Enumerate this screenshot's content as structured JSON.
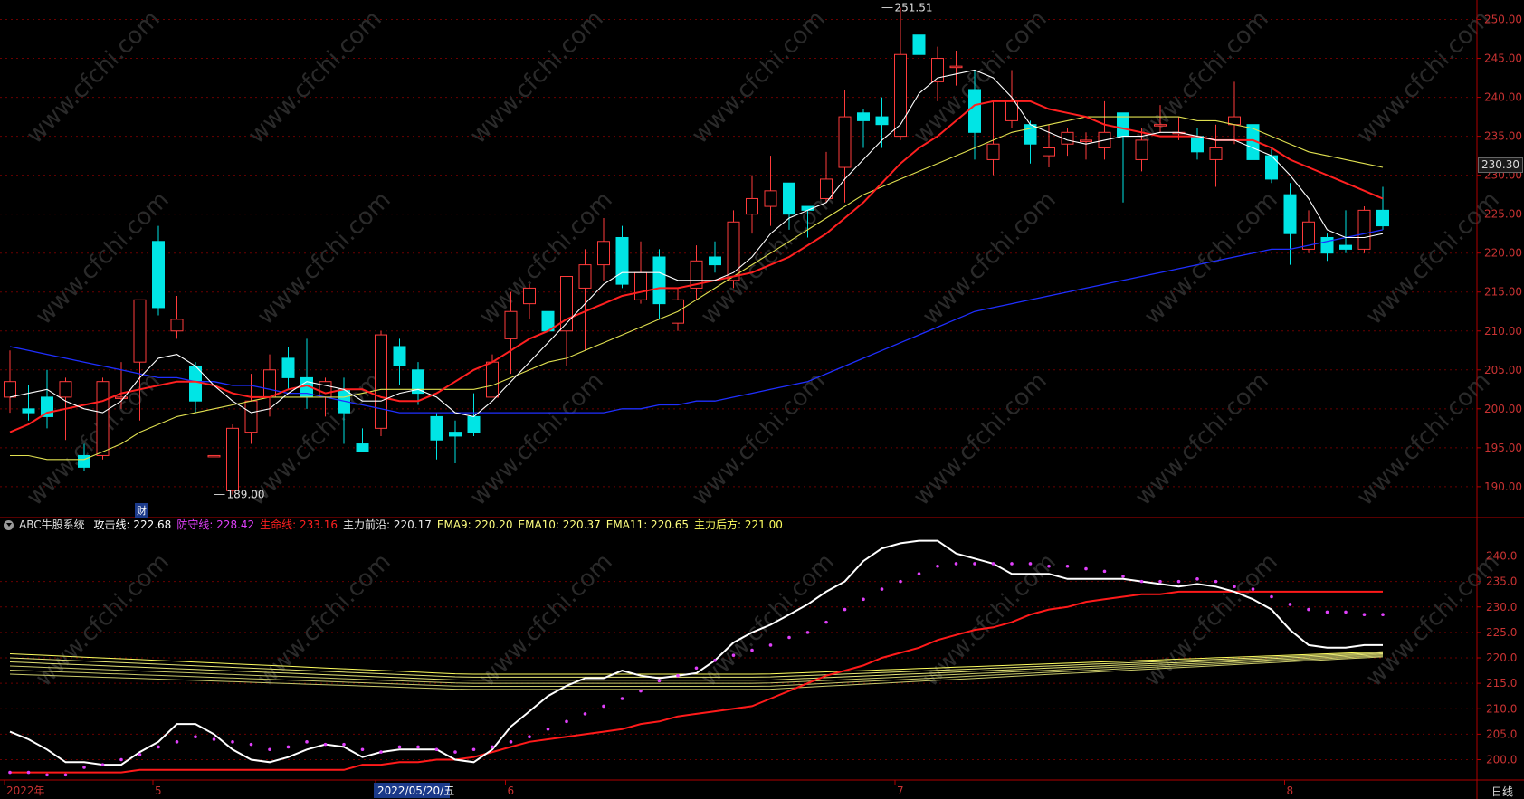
{
  "chart_data": {
    "type": "candlestick",
    "price_axis": {
      "ticks": [
        "190.00",
        "195.00",
        "200.00",
        "205.00",
        "210.00",
        "215.00",
        "220.00",
        "225.00",
        "230.00",
        "235.00",
        "240.00",
        "245.00",
        "250.00"
      ],
      "range": [
        186.5,
        252.5
      ]
    },
    "indicator_axis": {
      "ticks": [
        "200.0",
        "205.0",
        "210.0",
        "215.0",
        "220.0",
        "225.0",
        "230.0",
        "235.0",
        "240.0"
      ],
      "range": [
        196.0,
        244.0
      ]
    },
    "date_labels": [
      {
        "text": "2022年",
        "bar": 0
      },
      {
        "text": "5",
        "bar": 8
      },
      {
        "text": "2022/05/20/五",
        "bar": 20,
        "highlight": true
      },
      {
        "text": "6",
        "bar": 27
      },
      {
        "text": "7",
        "bar": 48
      },
      {
        "text": "8",
        "bar": 69
      }
    ],
    "high_label": {
      "text": "251.51",
      "bar": 47,
      "price": 251.51
    },
    "low_label": {
      "text": "189.00",
      "bar": 11,
      "price": 189.0
    },
    "current_price": "230.30",
    "finance_marker": {
      "text": "财",
      "bar": 7
    },
    "candles": [
      [
        201.5,
        203.5,
        207.5,
        199.5
      ],
      [
        200.0,
        199.5,
        203.0,
        198.5
      ],
      [
        201.5,
        199.0,
        205.0,
        197.5
      ],
      [
        201.5,
        203.5,
        204.0,
        196.0
      ],
      [
        194.0,
        192.5,
        195.5,
        192.0
      ],
      [
        194.0,
        203.5,
        204.0,
        193.5
      ],
      [
        201.5,
        201.5,
        206.0,
        200.0
      ],
      [
        206.0,
        214.0,
        214.0,
        198.5
      ],
      [
        221.5,
        213.0,
        223.5,
        212.0
      ],
      [
        210.0,
        211.5,
        214.5,
        209.0
      ],
      [
        205.5,
        201.0,
        206.0,
        199.5
      ],
      [
        194.0,
        194.0,
        196.5,
        190.0
      ],
      [
        189.5,
        197.5,
        198.0,
        189.0
      ],
      [
        197.0,
        201.0,
        204.5,
        195.5
      ],
      [
        201.5,
        205.0,
        207.0,
        199.0
      ],
      [
        206.5,
        204.0,
        208.0,
        202.5
      ],
      [
        204.0,
        201.5,
        209.0,
        200.0
      ],
      [
        201.5,
        203.5,
        204.0,
        199.0
      ],
      [
        202.5,
        199.5,
        204.0,
        195.5
      ],
      [
        195.5,
        194.5,
        197.5,
        194.5
      ],
      [
        197.5,
        209.5,
        210.0,
        196.5
      ],
      [
        208.0,
        205.5,
        209.0,
        203.0
      ],
      [
        205.0,
        202.0,
        206.0,
        200.5
      ],
      [
        199.0,
        196.0,
        199.5,
        193.5
      ],
      [
        197.0,
        196.5,
        198.5,
        193.0
      ],
      [
        199.0,
        197.0,
        202.0,
        196.5
      ],
      [
        201.5,
        206.0,
        207.0,
        201.5
      ],
      [
        209.0,
        212.5,
        215.0,
        204.5
      ],
      [
        213.5,
        215.5,
        216.0,
        211.5
      ],
      [
        212.5,
        210.0,
        215.5,
        207.5
      ],
      [
        210.0,
        217.0,
        217.0,
        205.5
      ],
      [
        215.5,
        218.5,
        220.5,
        207.5
      ],
      [
        218.5,
        221.5,
        224.5,
        216.5
      ],
      [
        222.0,
        216.0,
        223.5,
        215.5
      ],
      [
        214.0,
        217.5,
        221.5,
        213.5
      ],
      [
        219.5,
        213.5,
        220.5,
        211.5
      ],
      [
        211.0,
        214.0,
        215.5,
        210.0
      ],
      [
        215.5,
        219.0,
        221.0,
        214.0
      ],
      [
        219.5,
        218.5,
        221.5,
        217.5
      ],
      [
        216.5,
        224.0,
        225.5,
        215.5
      ],
      [
        225.0,
        227.0,
        230.0,
        222.5
      ],
      [
        226.0,
        228.0,
        232.5,
        223.5
      ],
      [
        229.0,
        225.0,
        229.0,
        223.0
      ],
      [
        226.0,
        225.5,
        226.0,
        222.0
      ],
      [
        227.0,
        229.5,
        233.0,
        226.5
      ],
      [
        231.0,
        237.5,
        241.0,
        226.5
      ],
      [
        238.0,
        237.0,
        238.5,
        233.5
      ],
      [
        237.5,
        236.5,
        240.0,
        233.5
      ],
      [
        235.0,
        245.5,
        251.5,
        234.5
      ],
      [
        248.0,
        245.5,
        249.5,
        241.0
      ],
      [
        242.0,
        245.0,
        246.5,
        239.5
      ],
      [
        244.0,
        244.0,
        246.0,
        241.5
      ],
      [
        241.0,
        235.5,
        243.5,
        232.0
      ],
      [
        232.0,
        234.0,
        239.5,
        230.0
      ],
      [
        237.0,
        239.5,
        243.5,
        236.0
      ],
      [
        236.5,
        234.0,
        237.0,
        231.5
      ],
      [
        232.5,
        233.5,
        236.5,
        231.0
      ],
      [
        234.0,
        235.5,
        236.0,
        232.5
      ],
      [
        234.5,
        234.5,
        235.5,
        232.0
      ],
      [
        233.5,
        235.5,
        239.5,
        232.0
      ],
      [
        238.0,
        235.0,
        238.0,
        226.5
      ],
      [
        232.0,
        234.5,
        236.0,
        230.5
      ],
      [
        236.5,
        236.5,
        239.0,
        235.5
      ],
      [
        235.5,
        235.5,
        237.5,
        234.5
      ],
      [
        235.0,
        233.0,
        236.0,
        232.0
      ],
      [
        232.0,
        233.5,
        236.5,
        228.5
      ],
      [
        236.5,
        237.5,
        242.0,
        234.0
      ],
      [
        236.5,
        232.0,
        236.5,
        231.5
      ],
      [
        232.5,
        229.5,
        233.5,
        229.0
      ],
      [
        227.5,
        222.5,
        229.0,
        218.5
      ],
      [
        220.5,
        224.0,
        225.5,
        220.0
      ],
      [
        222.0,
        220.0,
        222.5,
        219.0
      ],
      [
        221.0,
        220.5,
        225.5,
        220.0
      ],
      [
        220.5,
        225.5,
        226.0,
        220.0
      ],
      [
        225.5,
        223.5,
        228.5,
        223.0
      ]
    ],
    "ma5": [
      201.5,
      202.0,
      202.5,
      201.0,
      200.0,
      199.5,
      201.0,
      204.0,
      206.5,
      207.0,
      205.5,
      203.0,
      201.0,
      199.5,
      200.0,
      202.0,
      203.5,
      203.0,
      202.5,
      201.0,
      201.0,
      202.0,
      202.5,
      201.5,
      199.5,
      199.0,
      201.0,
      203.5,
      206.0,
      208.5,
      211.0,
      213.5,
      216.0,
      217.5,
      217.5,
      217.5,
      216.5,
      216.5,
      216.5,
      217.5,
      219.5,
      222.5,
      224.5,
      225.5,
      226.5,
      229.5,
      232.0,
      234.5,
      236.5,
      240.5,
      242.5,
      243.0,
      243.5,
      242.5,
      240.0,
      236.5,
      235.5,
      234.5,
      234.0,
      234.5,
      235.0,
      235.0,
      235.5,
      235.5,
      235.0,
      234.5,
      234.5,
      233.5,
      232.5,
      230.0,
      227.0,
      223.0,
      222.0,
      222.0,
      222.5
    ],
    "ma10": [
      197.0,
      198.0,
      199.5,
      200.0,
      200.5,
      201.0,
      202.0,
      202.5,
      203.0,
      203.5,
      203.5,
      203.0,
      202.0,
      201.5,
      201.5,
      202.5,
      203.0,
      202.0,
      202.5,
      202.5,
      201.5,
      201.0,
      201.0,
      202.0,
      203.5,
      205.0,
      206.0,
      207.5,
      209.0,
      210.0,
      211.5,
      212.5,
      213.5,
      214.5,
      215.0,
      215.5,
      215.5,
      216.0,
      216.5,
      217.0,
      217.5,
      218.5,
      219.5,
      221.0,
      222.5,
      224.5,
      226.5,
      229.0,
      231.5,
      233.5,
      235.0,
      237.0,
      239.0,
      239.5,
      239.5,
      239.5,
      238.5,
      238.0,
      237.5,
      236.5,
      236.0,
      235.5,
      235.0,
      235.0,
      235.0,
      234.5,
      234.5,
      234.5,
      233.5,
      232.0,
      231.0,
      230.0,
      229.0,
      228.0,
      227.0
    ],
    "ma20": [
      194.0,
      194.0,
      193.5,
      193.5,
      193.5,
      194.5,
      195.5,
      197.0,
      198.0,
      199.0,
      199.5,
      200.0,
      200.5,
      201.0,
      201.5,
      201.5,
      201.5,
      201.5,
      201.5,
      202.0,
      202.5,
      202.5,
      202.5,
      202.5,
      202.5,
      202.5,
      203.0,
      204.0,
      205.0,
      206.0,
      206.5,
      207.5,
      208.5,
      209.5,
      210.5,
      211.5,
      212.5,
      214.0,
      215.5,
      217.0,
      218.5,
      220.0,
      221.5,
      223.0,
      224.5,
      226.0,
      227.5,
      228.5,
      229.5,
      230.5,
      231.5,
      232.5,
      233.5,
      234.5,
      235.5,
      236.0,
      236.5,
      237.0,
      237.5,
      237.5,
      237.5,
      237.5,
      237.5,
      237.5,
      237.0,
      237.0,
      236.5,
      236.0,
      235.0,
      234.0,
      233.0,
      232.5,
      232.0,
      231.5,
      231.0
    ],
    "ma60": [
      208.0,
      207.5,
      207.0,
      206.5,
      206.0,
      205.5,
      205.0,
      204.5,
      204.0,
      204.0,
      203.5,
      203.5,
      203.0,
      203.0,
      202.5,
      202.0,
      202.0,
      201.5,
      201.0,
      200.5,
      200.0,
      199.5,
      199.5,
      199.5,
      199.5,
      199.5,
      199.5,
      199.5,
      199.5,
      199.5,
      199.5,
      199.5,
      199.5,
      200.0,
      200.0,
      200.5,
      200.5,
      201.0,
      201.0,
      201.5,
      202.0,
      202.5,
      203.0,
      203.5,
      204.5,
      205.5,
      206.5,
      207.5,
      208.5,
      209.5,
      210.5,
      211.5,
      212.5,
      213.0,
      213.5,
      214.0,
      214.5,
      215.0,
      215.5,
      216.0,
      216.5,
      217.0,
      217.5,
      218.0,
      218.5,
      219.0,
      219.5,
      220.0,
      220.5,
      220.5,
      221.0,
      221.5,
      222.0,
      222.5,
      223.0
    ],
    "indicator": {
      "title": "ABC牛股系统",
      "labels": [
        {
          "name": "攻击线:",
          "value": "222.68",
          "color": "#ffffff"
        },
        {
          "name": "防守线:",
          "value": "228.42",
          "color": "#e040fb"
        },
        {
          "name": "生命线:",
          "value": "233.16",
          "color": "#ff2020"
        },
        {
          "name": "主力前沿:",
          "value": "220.17",
          "color": "#e8e8e8"
        },
        {
          "name": "EMA9:",
          "value": "220.20",
          "color": "#ffff80"
        },
        {
          "name": "EMA10:",
          "value": "220.37",
          "color": "#ffff80"
        },
        {
          "name": "EMA11:",
          "value": "220.65",
          "color": "#ffff80"
        },
        {
          "name": "主力后方:",
          "value": "221.00",
          "color": "#ffff60"
        }
      ],
      "attack": [
        205.5,
        204.0,
        202.0,
        199.5,
        199.5,
        199.0,
        199.0,
        201.5,
        203.5,
        207.0,
        207.0,
        205.0,
        202.0,
        200.0,
        199.5,
        200.5,
        202.0,
        203.0,
        202.5,
        200.5,
        201.5,
        202.0,
        202.0,
        202.0,
        200.0,
        199.5,
        202.0,
        206.5,
        209.5,
        212.5,
        214.5,
        216.0,
        216.0,
        217.5,
        216.5,
        216.0,
        216.5,
        217.0,
        219.5,
        223.0,
        225.0,
        226.5,
        228.5,
        230.5,
        233.0,
        235.0,
        239.0,
        241.5,
        242.5,
        243.0,
        243.0,
        240.5,
        239.5,
        238.5,
        236.5,
        236.5,
        236.5,
        235.5,
        235.5,
        235.5,
        235.5,
        235.0,
        234.5,
        234.0,
        234.5,
        234.0,
        233.0,
        231.5,
        229.5,
        225.5,
        222.5,
        222.0,
        222.0,
        222.5,
        222.5
      ],
      "defense": [
        197.5,
        197.5,
        197.0,
        197.0,
        198.5,
        199.0,
        200.0,
        201.0,
        202.5,
        203.5,
        204.5,
        204.0,
        203.5,
        203.0,
        202.0,
        202.5,
        203.5,
        203.0,
        203.0,
        202.0,
        201.5,
        202.5,
        202.5,
        202.0,
        201.5,
        202.0,
        202.5,
        203.5,
        204.5,
        206.0,
        207.5,
        209.0,
        210.5,
        212.0,
        213.5,
        215.5,
        216.5,
        218.0,
        219.5,
        220.5,
        221.5,
        222.5,
        224.0,
        225.0,
        227.0,
        229.5,
        231.5,
        233.5,
        235.0,
        236.5,
        238.0,
        238.5,
        238.5,
        238.5,
        238.5,
        238.5,
        238.0,
        238.0,
        237.5,
        237.0,
        236.0,
        235.0,
        235.0,
        235.0,
        235.5,
        235.0,
        234.0,
        233.5,
        232.0,
        230.5,
        229.5,
        229.0,
        229.0,
        228.5,
        228.5
      ],
      "life": [
        197.5,
        197.5,
        197.5,
        197.5,
        197.5,
        197.5,
        197.5,
        198.0,
        198.0,
        198.0,
        198.0,
        198.0,
        198.0,
        198.0,
        198.0,
        198.0,
        198.0,
        198.0,
        198.0,
        199.0,
        199.0,
        199.5,
        199.5,
        200.0,
        200.0,
        200.5,
        201.5,
        202.5,
        203.5,
        204.0,
        204.5,
        205.0,
        205.5,
        206.0,
        207.0,
        207.5,
        208.5,
        209.0,
        209.5,
        210.0,
        210.5,
        212.0,
        213.5,
        215.0,
        216.5,
        217.5,
        218.5,
        220.0,
        221.0,
        222.0,
        223.5,
        224.5,
        225.5,
        226.0,
        227.0,
        228.5,
        229.5,
        230.0,
        231.0,
        231.5,
        232.0,
        232.5,
        232.5,
        233.0,
        233.0,
        233.0,
        233.0,
        233.0,
        233.0,
        233.0,
        233.0,
        233.0,
        233.0,
        233.0,
        233.0
      ],
      "band_start": [
        220.8,
        220.0,
        219.2,
        218.4,
        217.6,
        216.8
      ],
      "band_mid": [
        216.8,
        216.2,
        215.6,
        215.0,
        214.4,
        213.8
      ],
      "band_end": [
        221.2,
        221.0,
        220.8,
        220.6,
        220.4,
        220.2
      ]
    }
  },
  "period_label": "日线",
  "watermark": "www.cfchi.com",
  "colors": {
    "up": "#ff3b3b",
    "down": "#00e5e5",
    "ma5": "#ffffff",
    "ma10": "#ff2020",
    "ma20": "#e0e050",
    "ma60": "#1f2fff",
    "grid": "#6a0000",
    "axis": "#b00000"
  }
}
